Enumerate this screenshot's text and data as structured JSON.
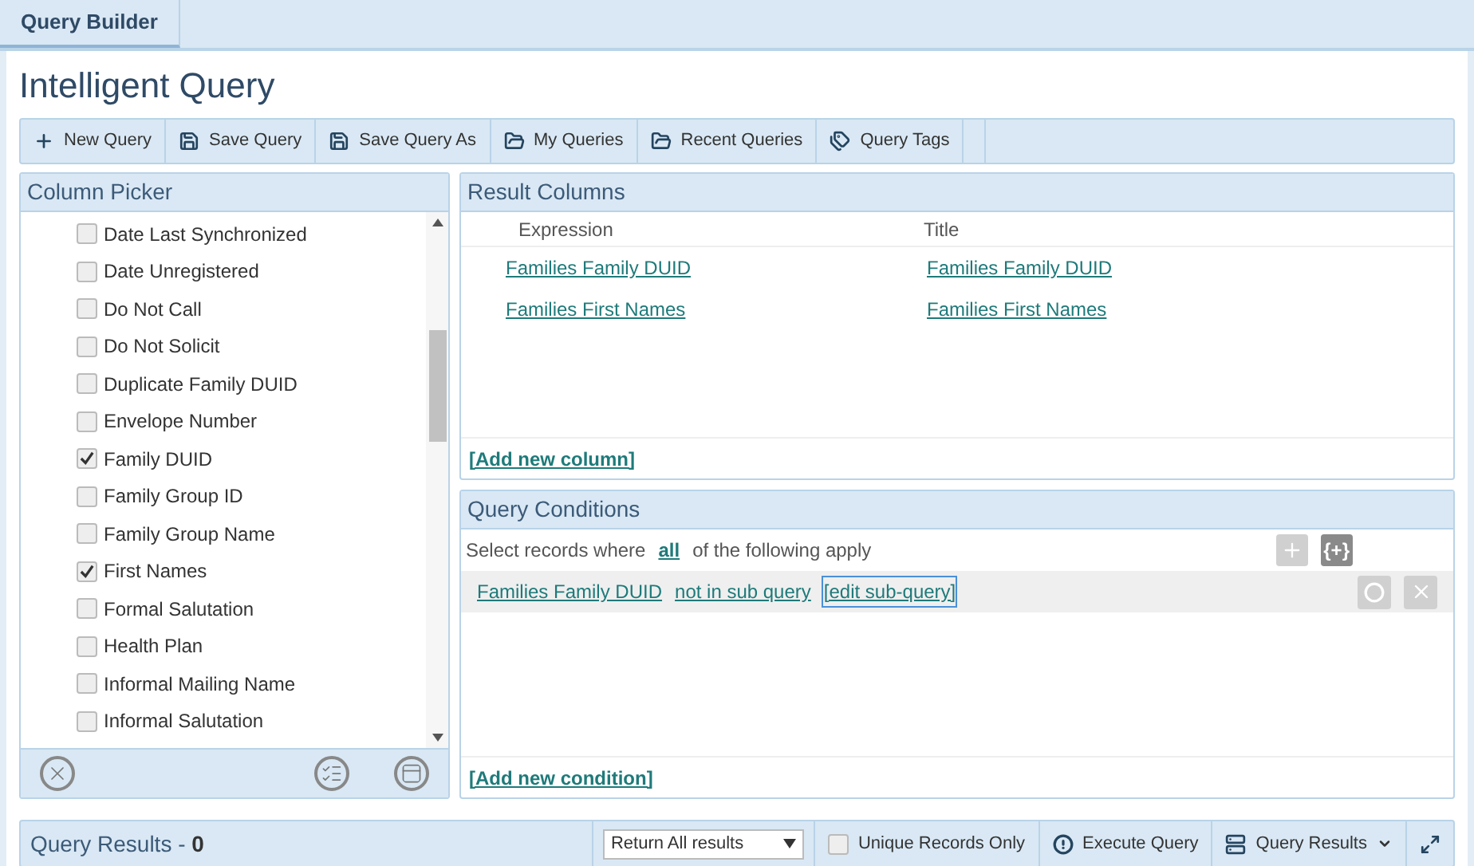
{
  "tabs": [
    {
      "label": "Query Builder",
      "selected": true
    }
  ],
  "title": "Intelligent Query",
  "toolbar": [
    {
      "label": "New Query"
    },
    {
      "label": "Save Query"
    },
    {
      "label": "Save Query As"
    },
    {
      "label": "My Queries"
    },
    {
      "label": "Recent Queries"
    },
    {
      "label": "Query Tags"
    }
  ],
  "column_picker": {
    "title": "Column Picker",
    "items": [
      {
        "label": "Date Last Synchronized",
        "checked": false
      },
      {
        "label": "Date Unregistered",
        "checked": false
      },
      {
        "label": "Do Not Call",
        "checked": false
      },
      {
        "label": "Do Not Solicit",
        "checked": false
      },
      {
        "label": "Duplicate Family DUID",
        "checked": false
      },
      {
        "label": "Envelope Number",
        "checked": false
      },
      {
        "label": "Family DUID",
        "checked": true
      },
      {
        "label": "Family Group ID",
        "checked": false
      },
      {
        "label": "Family Group Name",
        "checked": false
      },
      {
        "label": "First Names",
        "checked": true
      },
      {
        "label": "Formal Salutation",
        "checked": false
      },
      {
        "label": "Health Plan",
        "checked": false
      },
      {
        "label": "Informal Mailing Name",
        "checked": false
      },
      {
        "label": "Informal Salutation",
        "checked": false
      }
    ]
  },
  "result_columns": {
    "title": "Result Columns",
    "columns": [
      "Expression",
      "Title"
    ],
    "rows": [
      [
        "Families Family DUID",
        "Families Family DUID"
      ],
      [
        "Families First Names",
        "Families First Names"
      ]
    ],
    "add_link": "[Add new column]"
  },
  "query_conditions": {
    "title": "Query Conditions",
    "prefix": "Select records where",
    "match": "all",
    "suffix": "of the following apply",
    "add_group_button": "{+}",
    "conditions": [
      {
        "field": "Families Family DUID",
        "operator": "not in sub query",
        "edit": "[edit sub-query]"
      }
    ],
    "add_link": "[Add new condition]"
  },
  "results_bar": {
    "title": "Query Results - ",
    "count": "0",
    "return_select": "Return All results",
    "unique_label": "Unique Records Only",
    "unique_checked": false,
    "execute": "Execute Query",
    "results_menu": "Query Results"
  }
}
